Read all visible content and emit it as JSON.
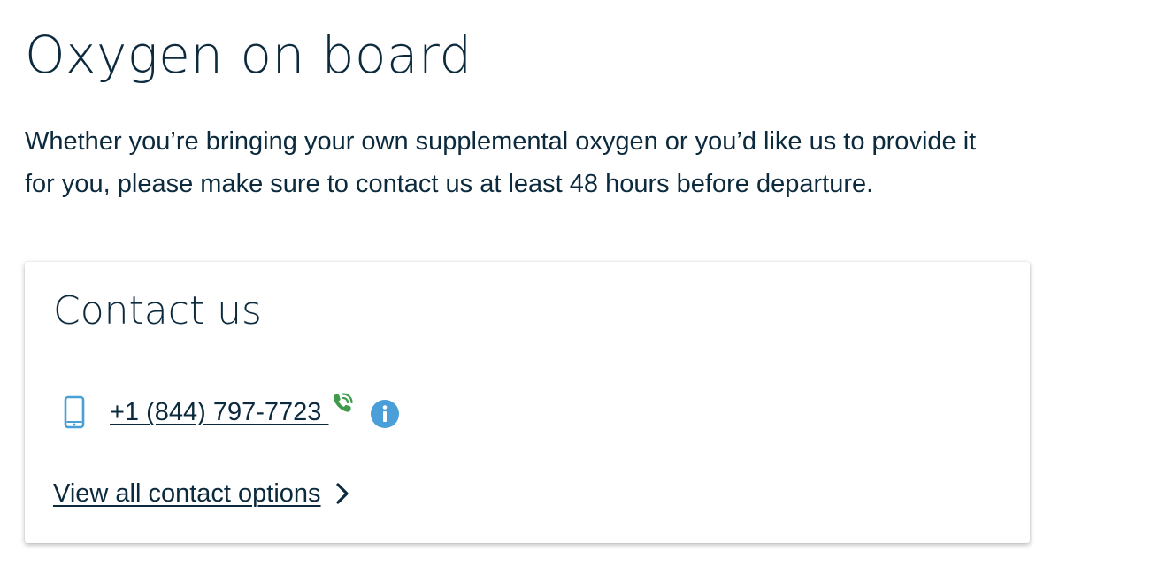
{
  "page": {
    "title": "Oxygen on board",
    "intro": "Whether you’re bringing your own supplemental oxygen or you’d like us to provide it for you, please make sure to contact us at least 48 hours before departure."
  },
  "contact_card": {
    "title": "Contact us",
    "phone": {
      "icon": "mobile-phone-icon",
      "number": "+1 (844) 797-7723 ",
      "call_icon": "phone-call-icon",
      "info_icon": "info-icon"
    },
    "view_all": {
      "label": "View all contact options",
      "icon": "chevron-right-icon"
    }
  },
  "colors": {
    "text": "#0b2a3d",
    "icon_blue": "#4a9fd8",
    "call_green": "#3f9a4a",
    "card_bg": "#ffffff"
  }
}
